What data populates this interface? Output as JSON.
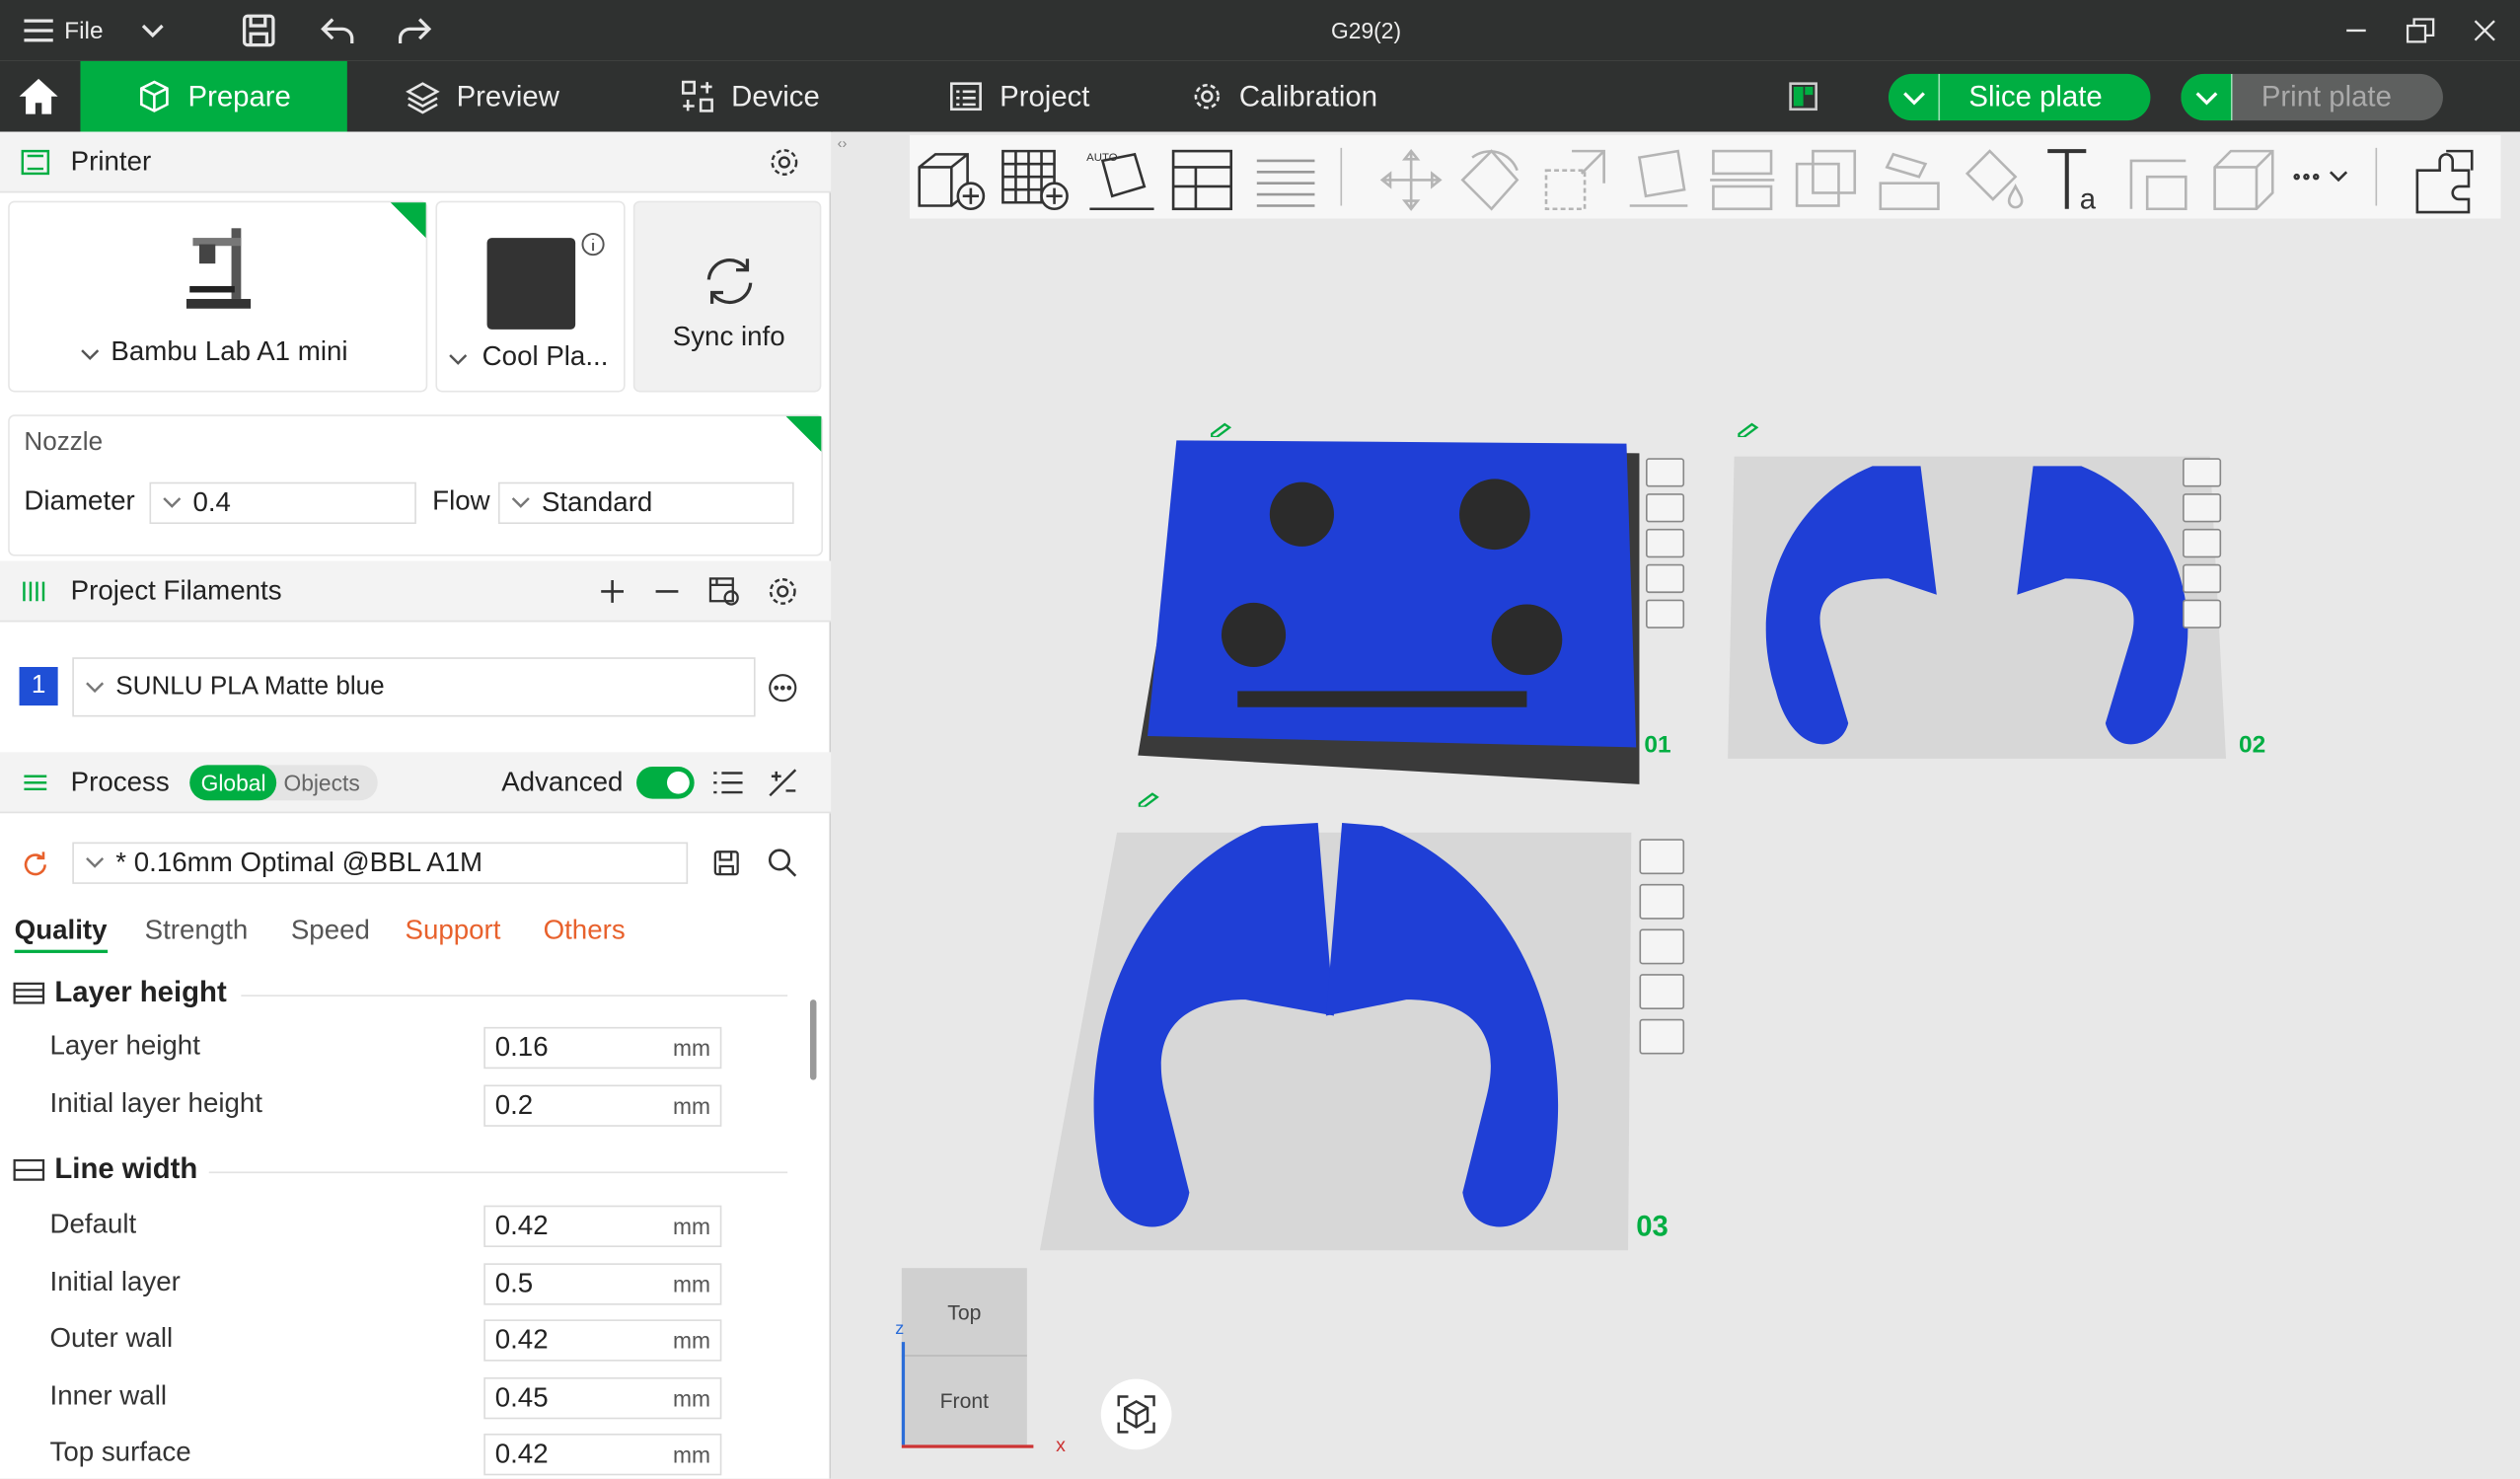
{
  "window": {
    "title": "G29(2)",
    "file_menu": "File"
  },
  "tabs": [
    {
      "label": "Prepare"
    },
    {
      "label": "Preview"
    },
    {
      "label": "Device"
    },
    {
      "label": "Project"
    },
    {
      "label": "Calibration"
    }
  ],
  "actions": {
    "slice_plate": "Slice plate",
    "print_plate": "Print plate"
  },
  "printer": {
    "header": "Printer",
    "name": "Bambu Lab A1 mini",
    "plate": "Cool Pla...",
    "sync": "Sync info"
  },
  "nozzle": {
    "header": "Nozzle",
    "diameter_label": "Diameter",
    "diameter_value": "0.4",
    "flow_label": "Flow",
    "flow_value": "Standard"
  },
  "filaments": {
    "header": "Project Filaments",
    "items": [
      {
        "index": "1",
        "name": "SUNLU PLA Matte blue",
        "color": "#1f4fd6"
      }
    ]
  },
  "process": {
    "header": "Process",
    "toggle_global": "Global",
    "toggle_objects": "Objects",
    "advanced_label": "Advanced",
    "preset": "* 0.16mm Optimal @BBL A1M",
    "subtabs": [
      "Quality",
      "Strength",
      "Speed",
      "Support",
      "Others"
    ]
  },
  "settings": {
    "layer_group": "Layer height",
    "layer_rows": [
      {
        "label": "Layer height",
        "value": "0.16",
        "unit": "mm"
      },
      {
        "label": "Initial layer height",
        "value": "0.2",
        "unit": "mm"
      }
    ],
    "line_group": "Line width",
    "line_rows": [
      {
        "label": "Default",
        "value": "0.42",
        "unit": "mm"
      },
      {
        "label": "Initial layer",
        "value": "0.5",
        "unit": "mm"
      },
      {
        "label": "Outer wall",
        "value": "0.42",
        "unit": "mm"
      },
      {
        "label": "Inner wall",
        "value": "0.45",
        "unit": "mm"
      },
      {
        "label": "Top surface",
        "value": "0.42",
        "unit": "mm"
      }
    ]
  },
  "plates": [
    {
      "label": "01"
    },
    {
      "label": "02"
    },
    {
      "label": "03"
    }
  ],
  "view_cube": {
    "top": "Top",
    "front": "Front",
    "axis_z": "z",
    "axis_x": "x"
  },
  "colors": {
    "accent": "#00ae42",
    "model": "#1f3fd6",
    "titlebar": "#2f3130",
    "warning": "#e8612c"
  }
}
